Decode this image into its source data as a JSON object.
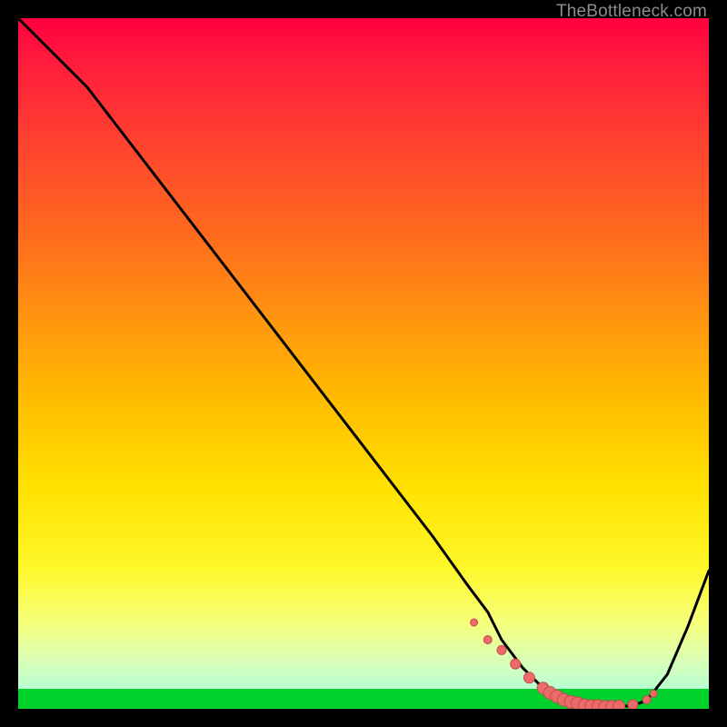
{
  "watermark": "TheBottleneck.com",
  "colors": {
    "background": "#000000",
    "curve": "#000000",
    "markers_fill": "#ed6a6a",
    "markers_stroke": "#c24d4d"
  },
  "chart_data": {
    "type": "line",
    "title": "",
    "xlabel": "",
    "ylabel": "",
    "xlim": [
      0,
      100
    ],
    "ylim": [
      0,
      100
    ],
    "x": [
      0,
      6,
      10,
      20,
      30,
      40,
      50,
      60,
      65,
      68,
      70,
      73,
      76,
      79,
      82,
      85,
      87,
      89,
      91,
      94,
      97,
      100
    ],
    "y": [
      100,
      94,
      90,
      77,
      64,
      51,
      38,
      25,
      18,
      14,
      10,
      6,
      3,
      1.2,
      0.5,
      0.3,
      0.3,
      0.5,
      1.2,
      5,
      12,
      20
    ],
    "markers_x": [
      66,
      68,
      70,
      72,
      74,
      76,
      77,
      78,
      79,
      80,
      81,
      82,
      83,
      84,
      85,
      86,
      87,
      89,
      91,
      92
    ],
    "markers_y": [
      12.5,
      10,
      8.5,
      6.5,
      4.5,
      3,
      2.3,
      1.8,
      1.3,
      1.0,
      0.8,
      0.5,
      0.4,
      0.4,
      0.3,
      0.3,
      0.4,
      0.6,
      1.3,
      2.2
    ],
    "markers_r": [
      4,
      4.5,
      5,
      5.5,
      6,
      6.5,
      7,
      7,
      7,
      7,
      7,
      7,
      7,
      7,
      7,
      7,
      6.5,
      5.5,
      4.5,
      4
    ]
  }
}
